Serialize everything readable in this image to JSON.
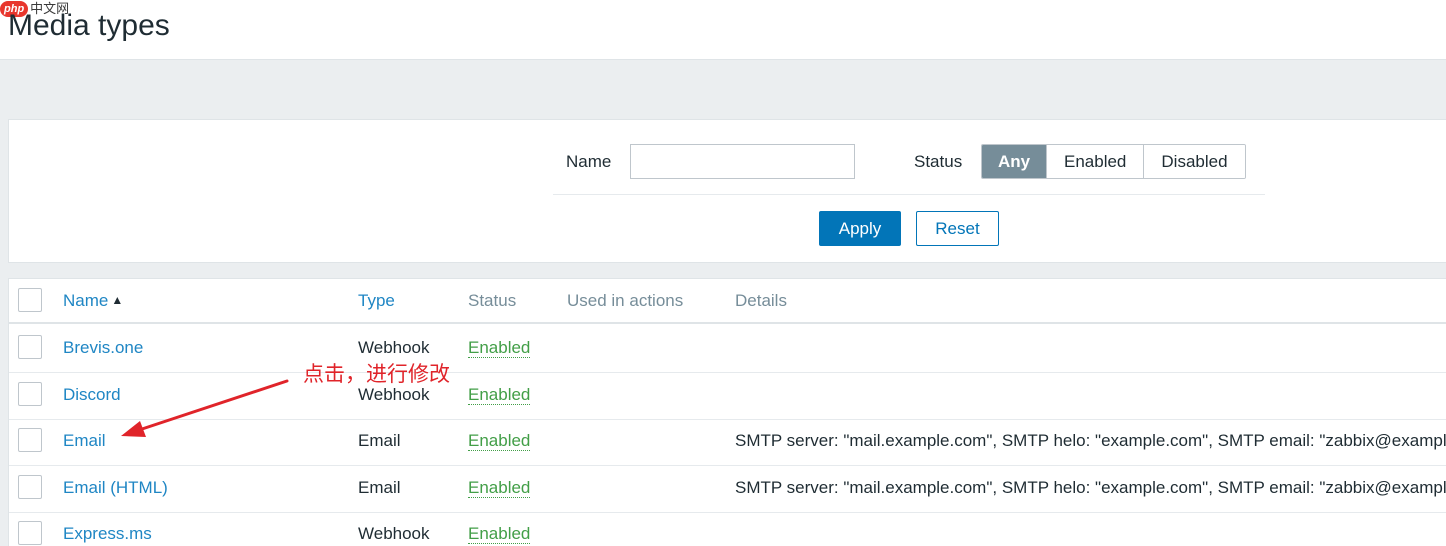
{
  "page": {
    "title": "Media types"
  },
  "watermark": {
    "badge": "php",
    "text": "中文网"
  },
  "filter": {
    "name_label": "Name",
    "name_value": "",
    "status_label": "Status",
    "status_options": [
      "Any",
      "Enabled",
      "Disabled"
    ],
    "status_selected": "Any",
    "apply_label": "Apply",
    "reset_label": "Reset"
  },
  "table": {
    "columns": {
      "name": "Name",
      "type": "Type",
      "status": "Status",
      "used_in_actions": "Used in actions",
      "details": "Details"
    },
    "sort": {
      "column": "Name",
      "direction": "asc"
    },
    "rows": [
      {
        "name": "Brevis.one",
        "type": "Webhook",
        "status": "Enabled",
        "details": ""
      },
      {
        "name": "Discord",
        "type": "Webhook",
        "status": "Enabled",
        "details": ""
      },
      {
        "name": "Email",
        "type": "Email",
        "status": "Enabled",
        "details": "SMTP server: \"mail.example.com\", SMTP helo: \"example.com\", SMTP email: \"zabbix@example.com\""
      },
      {
        "name": "Email (HTML)",
        "type": "Email",
        "status": "Enabled",
        "details": "SMTP server: \"mail.example.com\", SMTP helo: \"example.com\", SMTP email: \"zabbix@example.com\""
      },
      {
        "name": "Express.ms",
        "type": "Webhook",
        "status": "Enabled",
        "details": ""
      }
    ]
  },
  "annotation": {
    "text": "点击，进行修改",
    "color": "#e0242a"
  },
  "colors": {
    "link": "#1f86c4",
    "enabled": "#429e47",
    "primary": "#0275b8",
    "segment_active": "#768d99"
  }
}
